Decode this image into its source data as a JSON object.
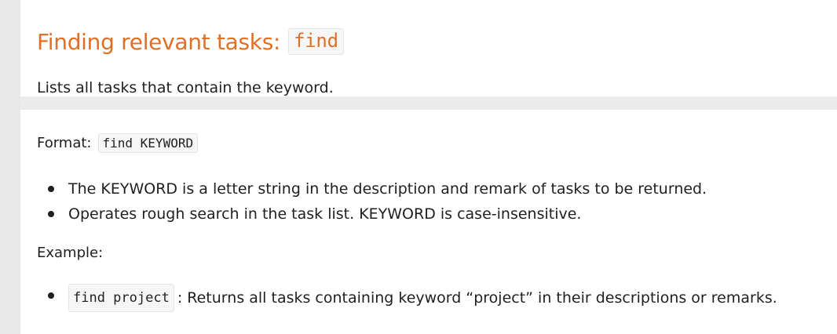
{
  "section": {
    "title": "Finding relevant tasks:",
    "command": "find",
    "description": "Lists all tasks that contain the keyword.",
    "format_label": "Format:",
    "format_code": "find KEYWORD",
    "bullets": [
      "The KEYWORD is a letter string in the description and remark of tasks to be returned.",
      "Operates rough search in the task list. KEYWORD is case-insensitive."
    ],
    "example_label": "Example:",
    "examples": [
      {
        "code": "find project",
        "text": ": Returns all tasks containing keyword “project” in their descriptions or remarks."
      }
    ]
  },
  "colors": {
    "heading": "#e06f26",
    "text": "#1f1f1f",
    "code_bg": "#f6f6f6",
    "sidebar": "#e8e8e8"
  }
}
